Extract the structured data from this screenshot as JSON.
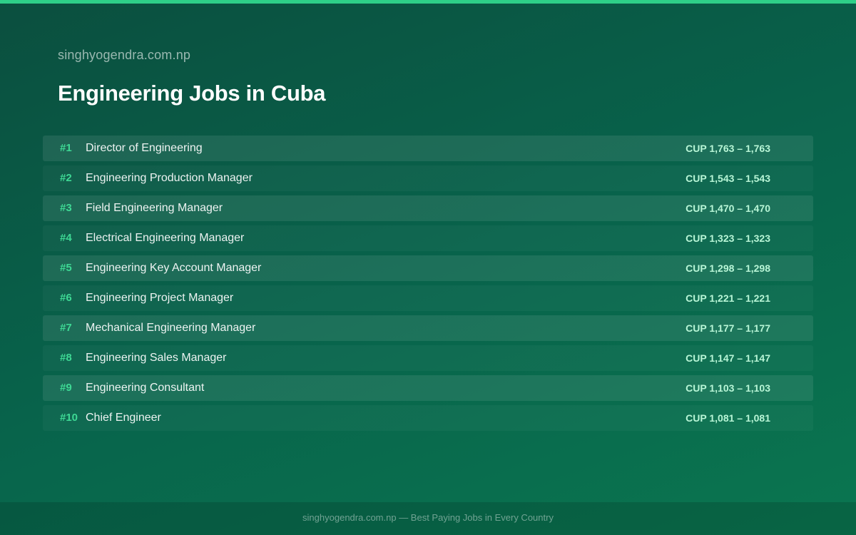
{
  "header": {
    "site_name": "singhyogendra.com.np",
    "title": "Engineering Jobs in Cuba"
  },
  "colors": {
    "accent": "#2ecf88",
    "rank": "#3ed894",
    "salary": "#b8f5d6",
    "background_start": "#0b4f3f",
    "background_end": "#0a7650"
  },
  "jobs": [
    {
      "rank": "#1",
      "title": "Director of Engineering",
      "salary": "CUP 1,763 – 1,763"
    },
    {
      "rank": "#2",
      "title": "Engineering Production Manager",
      "salary": "CUP 1,543 – 1,543"
    },
    {
      "rank": "#3",
      "title": "Field Engineering Manager",
      "salary": "CUP 1,470 – 1,470"
    },
    {
      "rank": "#4",
      "title": "Electrical Engineering Manager",
      "salary": "CUP 1,323 – 1,323"
    },
    {
      "rank": "#5",
      "title": "Engineering Key Account Manager",
      "salary": "CUP 1,298 – 1,298"
    },
    {
      "rank": "#6",
      "title": "Engineering Project Manager",
      "salary": "CUP 1,221 – 1,221"
    },
    {
      "rank": "#7",
      "title": "Mechanical Engineering Manager",
      "salary": "CUP 1,177 – 1,177"
    },
    {
      "rank": "#8",
      "title": "Engineering Sales Manager",
      "salary": "CUP 1,147 – 1,147"
    },
    {
      "rank": "#9",
      "title": "Engineering Consultant",
      "salary": "CUP 1,103 – 1,103"
    },
    {
      "rank": "#10",
      "title": "Chief Engineer",
      "salary": "CUP 1,081 – 1,081"
    }
  ],
  "footer": {
    "text": "singhyogendra.com.np — Best Paying Jobs in Every Country"
  }
}
